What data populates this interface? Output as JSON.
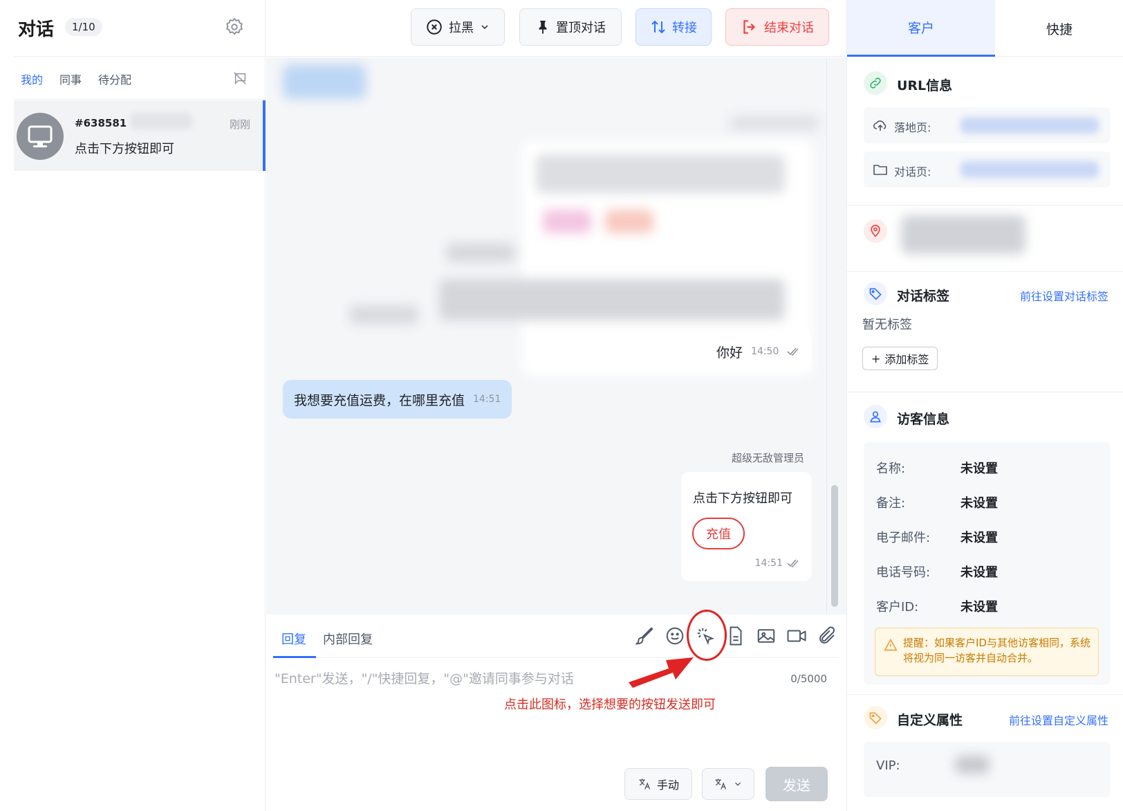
{
  "left": {
    "title": "对话",
    "count": "1/10",
    "tabs": [
      "我的",
      "同事",
      "待分配"
    ],
    "conversation": {
      "id": "#638581",
      "time": "刚刚",
      "preview": "点击下方按钮即可"
    }
  },
  "toolbar": {
    "block_label": "拉黑",
    "pin_label": "置顶对话",
    "transfer_label": "转接",
    "end_label": "结束对话"
  },
  "chat": {
    "hello": {
      "text": "你好",
      "time": "14:50"
    },
    "visitor_msg": {
      "text": "我想要充值运费，在哪里充值",
      "time": "14:51"
    },
    "sender": "超级无敌管理员",
    "card": {
      "text": "点击下方按钮即可",
      "button": "充值",
      "time": "14:51"
    }
  },
  "composer": {
    "tab_reply": "回复",
    "tab_internal": "内部回复",
    "placeholder": "\"Enter\"发送，\"/\"快捷回复，\"@\"邀请同事参与对话",
    "counter": "0/5000",
    "annotation": "点击此图标，选择想要的按钮发送即可",
    "manual_label": "手动",
    "send_label": "发送"
  },
  "right": {
    "tabs": [
      "客户",
      "快捷"
    ],
    "url_section": {
      "title": "URL信息",
      "landing_label": "落地页:",
      "chat_label": "对话页:"
    },
    "tags_section": {
      "title": "对话标签",
      "link": "前往设置对话标签",
      "empty": "暂无标签",
      "add": "添加标签"
    },
    "visitor_section": {
      "title": "访客信息",
      "rows": [
        {
          "key": "名称:",
          "value": "未设置"
        },
        {
          "key": "备注:",
          "value": "未设置"
        },
        {
          "key": "电子邮件:",
          "value": "未设置"
        },
        {
          "key": "电话号码:",
          "value": "未设置"
        },
        {
          "key": "客户ID:",
          "value": "未设置"
        }
      ],
      "warning": "提醒：如果客户ID与其他访客相同，系统将视为同一访客并自动合并。"
    },
    "custom_section": {
      "title": "自定义属性",
      "link": "前往设置自定义属性",
      "vip_label": "VIP:"
    }
  },
  "colors": {
    "accent": "#3370ff",
    "danger": "#f04040",
    "annotation": "#d92d20"
  }
}
